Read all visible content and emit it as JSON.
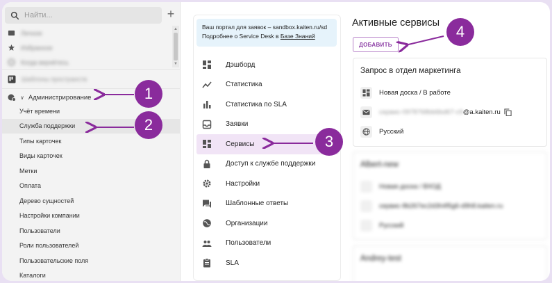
{
  "sidebar": {
    "search_placeholder": "Найти...",
    "add_symbol": "+",
    "favorites": [
      {
        "label": "Личное",
        "icon": "inbox-icon"
      },
      {
        "label": "Избранное",
        "icon": "star-icon"
      },
      {
        "label": "Когда вернётесь",
        "icon": "history-icon"
      }
    ],
    "templates_label": "Шаблоны пространств",
    "admin_label": "Администрирование",
    "admin_items": [
      "Учёт времени",
      "Служба поддержки",
      "Типы карточек",
      "Виды карточек",
      "Метки",
      "Оплата",
      "Дерево сущностей",
      "Настройки компании",
      "Пользователи",
      "Роли пользователей",
      "Пользовательские поля",
      "Каталоги"
    ],
    "active_index": 1
  },
  "portal": {
    "line1": "Ваш портал для заявок – sandbox.kaiten.ru/sd",
    "line2_prefix": "Подробнее о Service Desk в ",
    "line2_link": "Базе Знаний"
  },
  "menu": [
    {
      "label": "Дэшборд",
      "icon": "dashboard-icon"
    },
    {
      "label": "Статистика",
      "icon": "trending-icon"
    },
    {
      "label": "Статистика по SLA",
      "icon": "bar-chart-icon"
    },
    {
      "label": "Заявки",
      "icon": "inbox-tray-icon"
    },
    {
      "label": "Сервисы",
      "icon": "dashboard-icon",
      "active": true
    },
    {
      "label": "Доступ к службе поддержки",
      "icon": "lock-icon"
    },
    {
      "label": "Настройки",
      "icon": "gear-icon"
    },
    {
      "label": "Шаблонные ответы",
      "icon": "chat-icon"
    },
    {
      "label": "Организации",
      "icon": "globe-icon"
    },
    {
      "label": "Пользователи",
      "icon": "people-icon"
    },
    {
      "label": "SLA",
      "icon": "clipboard-icon"
    }
  ],
  "services": {
    "title": "Активные сервисы",
    "add_button": "ДОБАВИТЬ",
    "cards": [
      {
        "title": "Запрос в отдел маркетинга",
        "board": "Новая доска / В работе",
        "email_hidden": "сервис-0978768bb6bd67-c9",
        "email_domain": "@a.kaiten.ru",
        "language": "Русский"
      },
      {
        "title": "Albert-new",
        "board": "Новая доска / ВХОД",
        "email_hidden": "сервис-8b267ec2d3h4f5g6-d9h8.",
        "email_domain": "kaiten.ru",
        "language": "Русский"
      },
      {
        "title": "Andrey-test",
        "board": "",
        "email_hidden": "",
        "email_domain": "",
        "language": ""
      }
    ]
  },
  "annotations": [
    "1",
    "2",
    "3",
    "4"
  ],
  "colors": {
    "accent": "#8a2b9c",
    "active_menu_bg": "#f1e4f6",
    "banner_bg": "#e6f3fb",
    "button_border": "#b781c9"
  }
}
